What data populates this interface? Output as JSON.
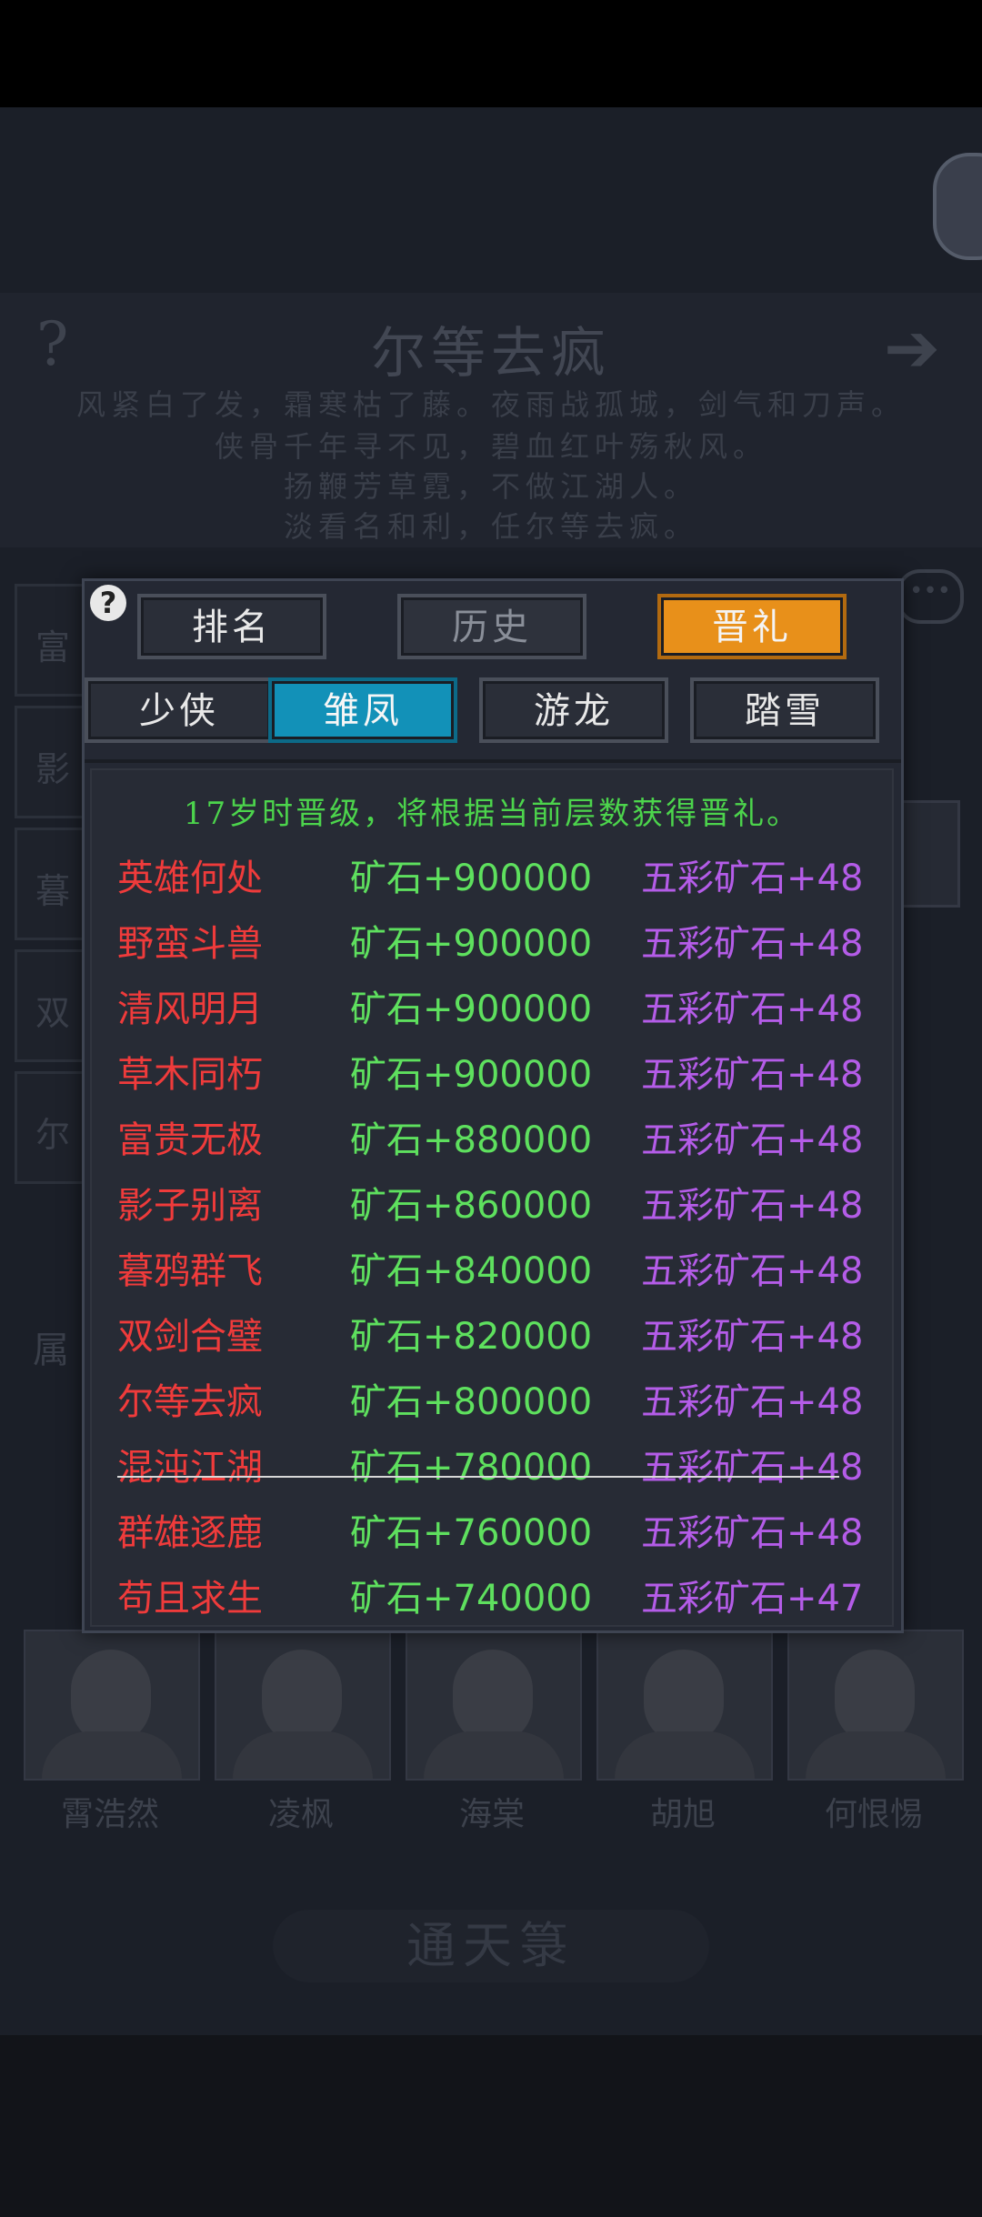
{
  "background": {
    "poem_title": "尔等去疯",
    "poem_lines": [
      "风紧白了发，霜寒枯了藤。夜雨战孤城，剑气和刀声。",
      "侠骨千年寻不见，碧血红叶殇秋风。",
      "扬鞭芳草霓，不做江湖人。",
      "淡看名和利，任尔等去疯。"
    ],
    "side_labels": [
      "富",
      "影",
      "暮",
      "双",
      "尔"
    ],
    "attr_label": "属",
    "heroes": [
      "霄浩然",
      "凌枫",
      "海棠",
      "胡旭",
      "何恨惕"
    ],
    "bottom_button": "通天箓"
  },
  "modal": {
    "help_icon": "?",
    "tabs": [
      "排名",
      "历史",
      "晋礼"
    ],
    "active_tab": "晋礼",
    "subtabs": [
      "少侠",
      "雏凤",
      "游龙",
      "踏雪"
    ],
    "active_subtab": "雏凤",
    "notice": "17岁时晋级，将根据当前层数获得晋礼。",
    "rows": [
      {
        "rank": "英雄何处",
        "ore": "矿石+900000",
        "colored_ore": "五彩矿石+48"
      },
      {
        "rank": "野蛮斗兽",
        "ore": "矿石+900000",
        "colored_ore": "五彩矿石+48"
      },
      {
        "rank": "清风明月",
        "ore": "矿石+900000",
        "colored_ore": "五彩矿石+48"
      },
      {
        "rank": "草木同朽",
        "ore": "矿石+900000",
        "colored_ore": "五彩矿石+48"
      },
      {
        "rank": "富贵无极",
        "ore": "矿石+880000",
        "colored_ore": "五彩矿石+48"
      },
      {
        "rank": "影子别离",
        "ore": "矿石+860000",
        "colored_ore": "五彩矿石+48"
      },
      {
        "rank": "暮鸦群飞",
        "ore": "矿石+840000",
        "colored_ore": "五彩矿石+48"
      },
      {
        "rank": "双剑合璧",
        "ore": "矿石+820000",
        "colored_ore": "五彩矿石+48"
      },
      {
        "rank": "尔等去疯",
        "ore": "矿石+800000",
        "colored_ore": "五彩矿石+48"
      },
      {
        "rank": "混沌江湖",
        "ore": "矿石+780000",
        "colored_ore": "五彩矿石+48"
      },
      {
        "rank": "群雄逐鹿",
        "ore": "矿石+760000",
        "colored_ore": "五彩矿石+48"
      },
      {
        "rank": "苟且求生",
        "ore": "矿石+740000",
        "colored_ore": "五彩矿石+47"
      }
    ]
  },
  "colors": {
    "tab_active": "#e8901a",
    "subtab_active": "#1291b8",
    "rank_text": "#ef3b3b",
    "ore_text": "#5ee05e",
    "colored_ore_text": "#b45ce8",
    "notice_text": "#4cd44c"
  }
}
